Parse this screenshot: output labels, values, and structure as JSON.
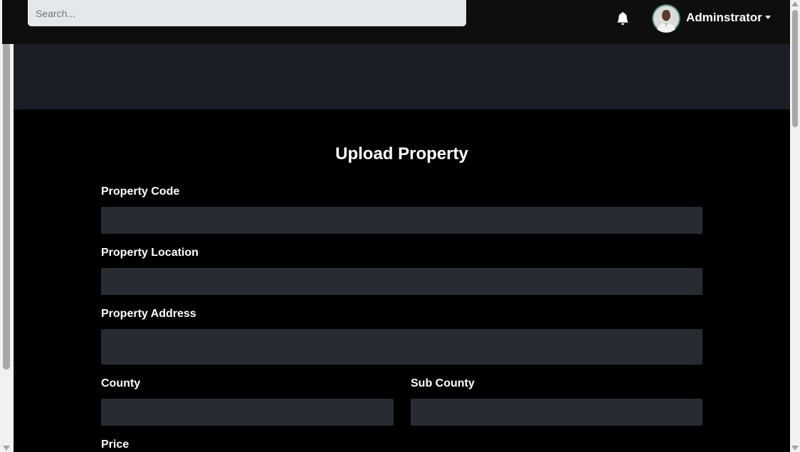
{
  "topbar": {
    "search": {
      "placeholder": "Search...",
      "value": ""
    },
    "notification_icon": "bell-icon",
    "user": {
      "name": "Adminstrator",
      "caret_icon": "caret-down-icon"
    }
  },
  "form": {
    "title": "Upload Property",
    "fields": {
      "property_code": {
        "label": "Property Code",
        "value": ""
      },
      "property_location": {
        "label": "Property Location",
        "value": ""
      },
      "property_address": {
        "label": "Property Address",
        "value": ""
      },
      "county": {
        "label": "County",
        "value": ""
      },
      "sub_county": {
        "label": "Sub County",
        "value": ""
      },
      "price": {
        "label": "Price"
      }
    }
  },
  "colors": {
    "topbar_bg": "#0e0e0e",
    "banner_bg": "#1b1e27",
    "main_bg": "#000000",
    "input_bg": "#272c33",
    "search_bg": "#e5e8eb",
    "text": "#ffffff"
  }
}
